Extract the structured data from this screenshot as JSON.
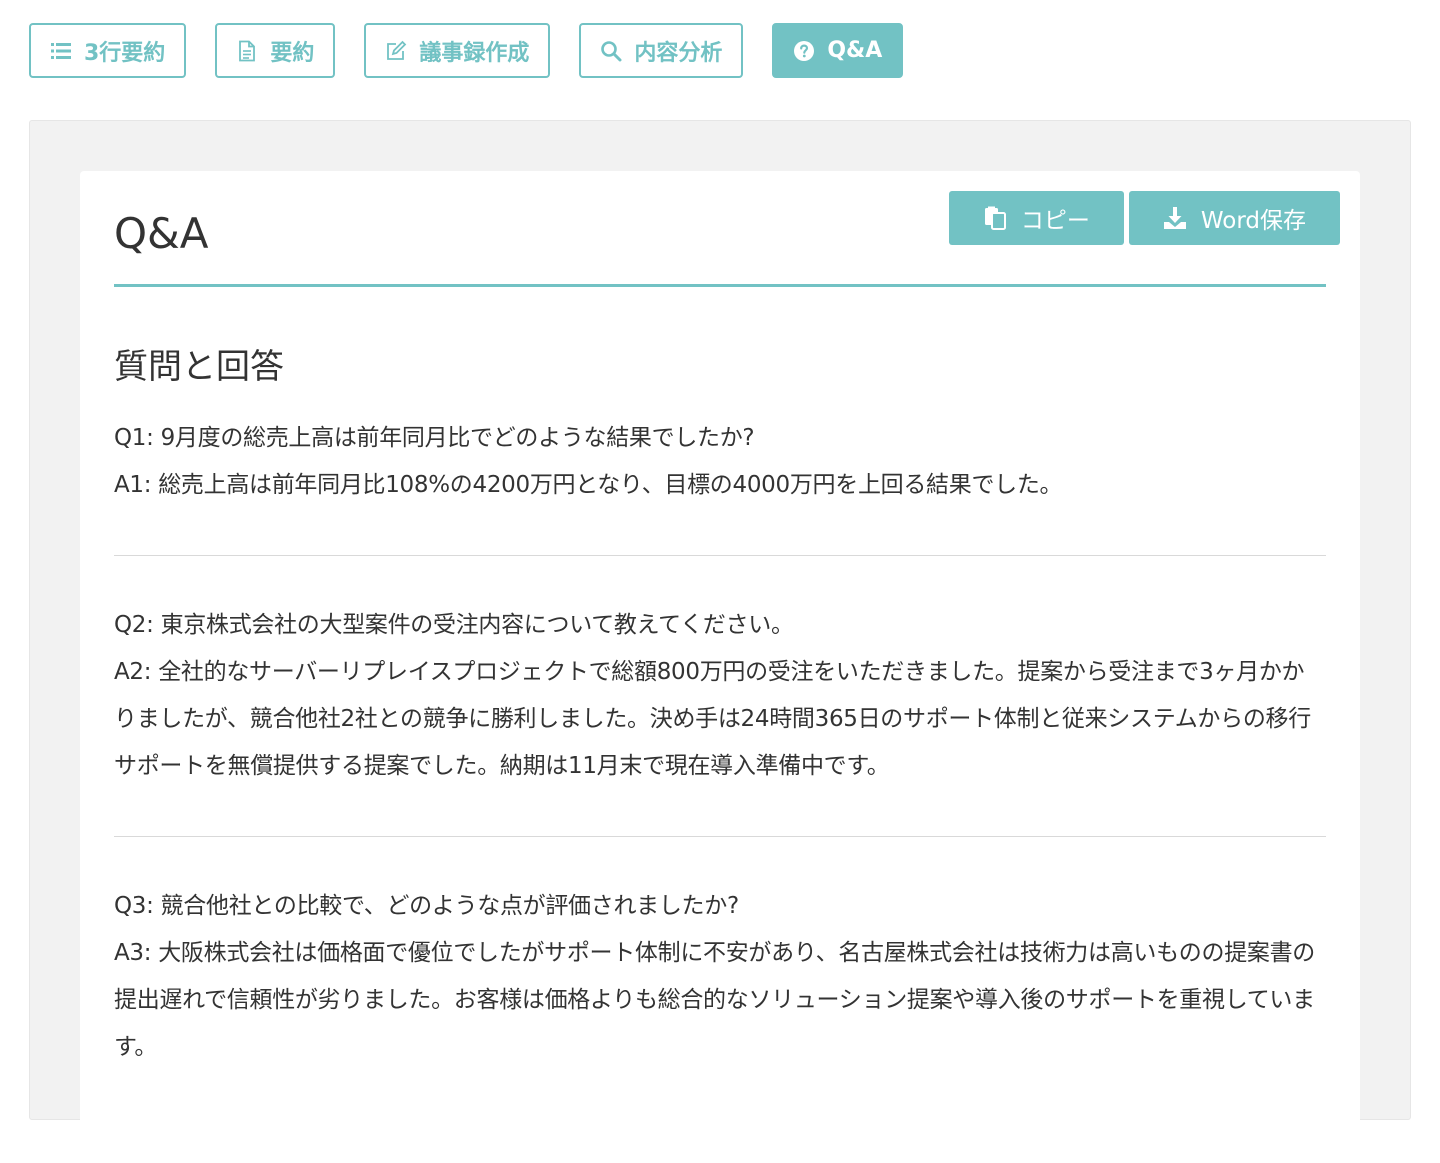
{
  "tabs": [
    {
      "label": "3行要約",
      "icon": "list-icon",
      "active": false
    },
    {
      "label": "要約",
      "icon": "document-icon",
      "active": false
    },
    {
      "label": "議事録作成",
      "icon": "edit-icon",
      "active": false
    },
    {
      "label": "内容分析",
      "icon": "search-icon",
      "active": false
    },
    {
      "label": "Q&A",
      "icon": "question-circle-icon",
      "active": true
    }
  ],
  "card": {
    "title": "Q&A",
    "copy_label": "コピー",
    "word_label": "Word保存",
    "section_heading": "質問と回答"
  },
  "qa": [
    {
      "q": "Q1: 9月度の総売上高は前年同月比でどのような結果でしたか?",
      "a": "A1: 総売上高は前年同月比108%の4200万円となり、目標の4000万円を上回る結果でした。"
    },
    {
      "q": "Q2: 東京株式会社の大型案件の受注内容について教えてください。",
      "a": "A2: 全社的なサーバーリプレイスプロジェクトで総額800万円の受注をいただきました。提案から受注まで3ヶ月かかりましたが、競合他社2社との競争に勝利しました。決め手は24時間365日のサポート体制と従来システムからの移行サポートを無償提供する提案でした。納期は11月末で現在導入準備中です。"
    },
    {
      "q": "Q3: 競合他社との比較で、どのような点が評価されましたか?",
      "a": "A3: 大阪株式会社は価格面で優位でしたがサポート体制に不安があり、名古屋株式会社は技術力は高いものの提案書の提出遅れで信頼性が劣りました。お客様は価格よりも総合的なソリューション提案や導入後のサポートを重視しています。"
    }
  ],
  "colors": {
    "accent": "#72c2c4",
    "text": "#333333",
    "panel": "#f2f2f2"
  }
}
